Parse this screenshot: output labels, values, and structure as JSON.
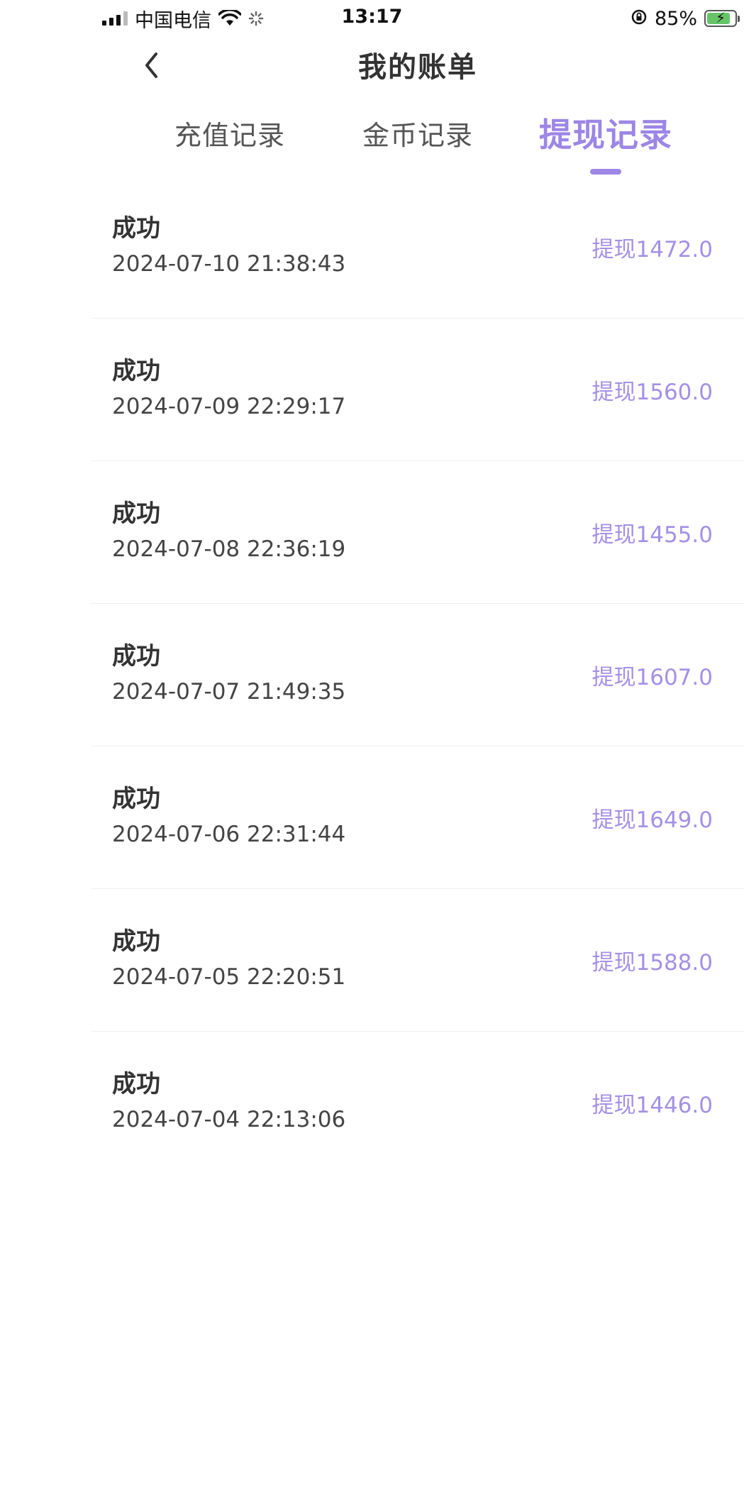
{
  "status_bar": {
    "carrier": "中国电信",
    "time": "13:17",
    "battery_percent": "85%",
    "battery_level": 0.85
  },
  "navbar": {
    "back_icon": "chevron-left-icon",
    "title": "我的账单"
  },
  "tabs": [
    {
      "label": "充值记录",
      "active": false
    },
    {
      "label": "金币记录",
      "active": false
    },
    {
      "label": "提现记录",
      "active": true
    }
  ],
  "colors": {
    "accent": "#9d86e5",
    "amount_text": "#a490e6"
  },
  "records": [
    {
      "status": "成功",
      "time": "2024-07-10 21:38:43",
      "amount": "提现1472.0"
    },
    {
      "status": "成功",
      "time": "2024-07-09 22:29:17",
      "amount": "提现1560.0"
    },
    {
      "status": "成功",
      "time": "2024-07-08 22:36:19",
      "amount": "提现1455.0"
    },
    {
      "status": "成功",
      "time": "2024-07-07 21:49:35",
      "amount": "提现1607.0"
    },
    {
      "status": "成功",
      "time": "2024-07-06 22:31:44",
      "amount": "提现1649.0"
    },
    {
      "status": "成功",
      "time": "2024-07-05 22:20:51",
      "amount": "提现1588.0"
    },
    {
      "status": "成功",
      "time": "2024-07-04 22:13:06",
      "amount": "提现1446.0"
    }
  ]
}
